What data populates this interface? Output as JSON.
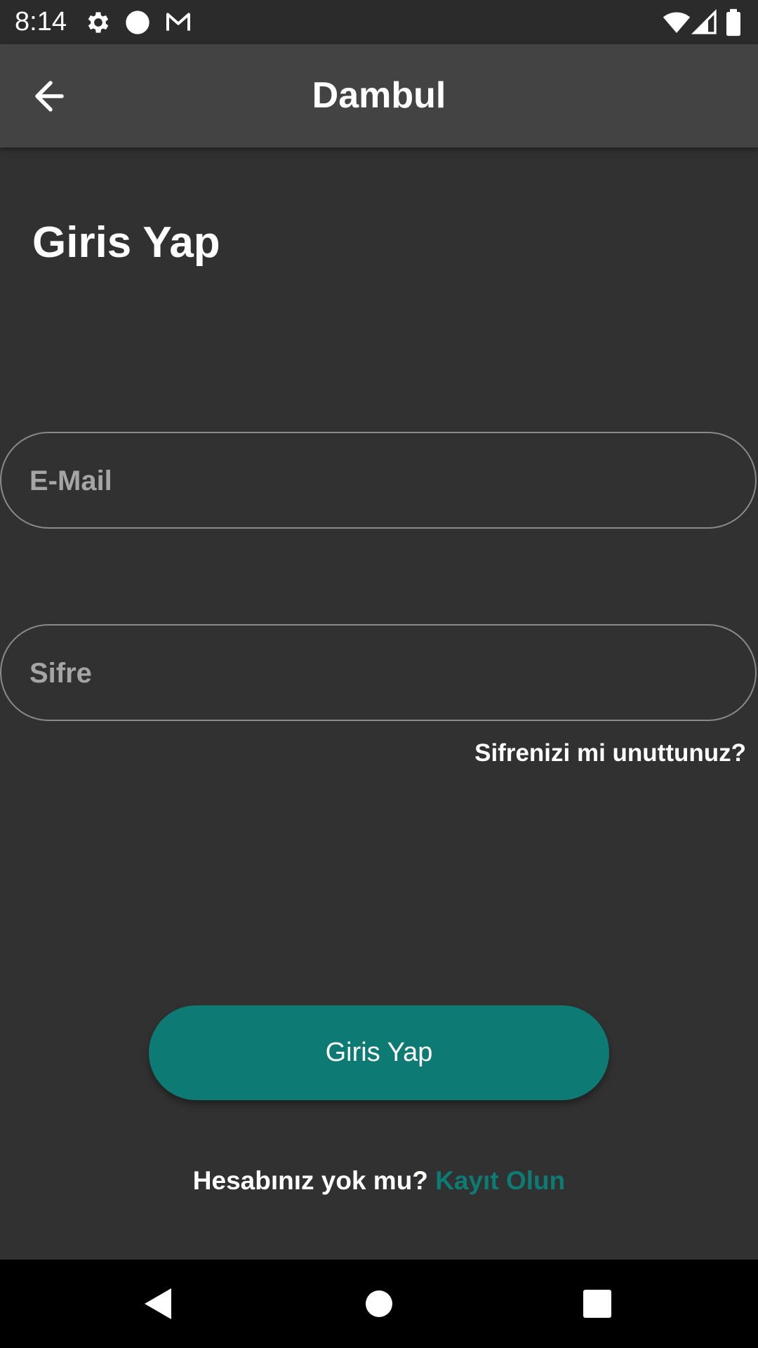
{
  "status_bar": {
    "time": "8:14",
    "left_icons": [
      "gear-icon",
      "circle-icon",
      "gmail-icon"
    ],
    "right_icons": [
      "wifi-icon",
      "signal-icon",
      "battery-icon"
    ]
  },
  "app_bar": {
    "title": "Dambul",
    "back_icon": "arrow-left-icon"
  },
  "login": {
    "heading": "Giris Yap",
    "email": {
      "placeholder": "E-Mail",
      "value": ""
    },
    "password": {
      "placeholder": "Sifre",
      "value": ""
    },
    "forgot_password": "Sifrenizi mi unuttunuz?",
    "submit_label": "Giris Yap",
    "register_prompt": "Hesabınız yok mu?",
    "register_link": "Kayıt Olun"
  },
  "colors": {
    "background": "#313131",
    "app_bar": "#434343",
    "accent": "#0d7b74"
  },
  "nav_bar": {
    "icons": [
      "back-triangle-icon",
      "home-circle-icon",
      "recents-square-icon"
    ]
  }
}
